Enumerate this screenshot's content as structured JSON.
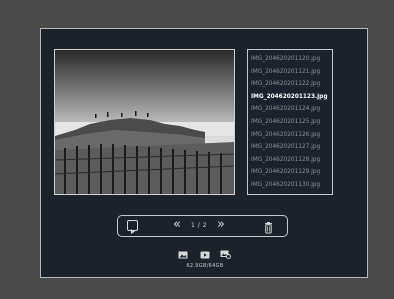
{
  "files": [
    "IMG_204620201120.jpg",
    "IMG_204620201121.jpg",
    "IMG_204620201122.jpg",
    "IMG_204620201123.jpg",
    "IMG_204620201124.jpg",
    "IMG_204620201125.jpg",
    "IMG_204620201126.jpg",
    "IMG_204620201127.jpg",
    "IMG_204620201128.jpg",
    "IMG_204620201129.jpg",
    "IMG_204620201130.jpg"
  ],
  "selected_index": 3,
  "controls": {
    "prev_glyph": "«",
    "page": "1 / 2",
    "next_glyph": "»"
  },
  "icons": {
    "play": "play-icon",
    "trash": "trash-icon",
    "photo_mode": "photo-icon",
    "video_mode": "video-icon",
    "image_settings": "image-settings-icon"
  },
  "storage": "62.9GB/64GB",
  "colors": {
    "background": "#4a4a4a",
    "panel": "#1c222b",
    "border": "#c9c9c9",
    "text_dim": "#8b919a",
    "text_active": "#ffffff"
  }
}
